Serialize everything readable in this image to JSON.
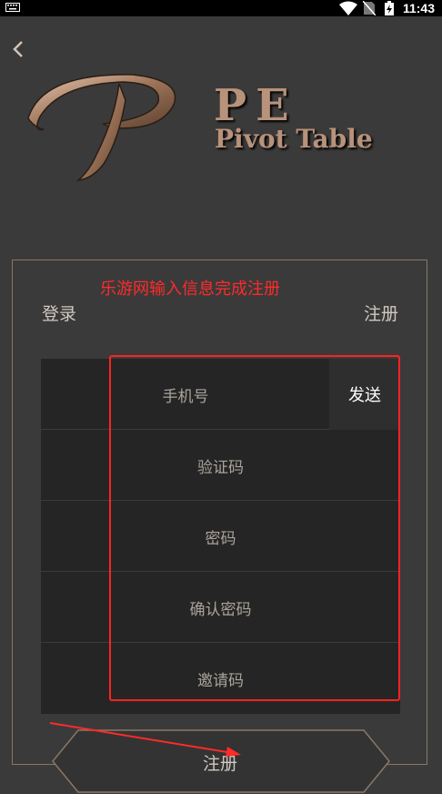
{
  "status_bar": {
    "time": "11:43",
    "icons": [
      "keyboard-icon",
      "wifi-icon",
      "no-sim-icon",
      "battery-charging-icon"
    ]
  },
  "header": {
    "back_icon": "chevron-left-icon",
    "logo_letter": "P",
    "brand_title": "PE",
    "brand_subtitle": "Pivot Table"
  },
  "annotation": {
    "text": "乐游网输入信息完成注册",
    "color": "#ff2a2a"
  },
  "tabs": {
    "login": "登录",
    "register": "注册"
  },
  "form": {
    "phone_placeholder": "手机号",
    "send_button": "发送",
    "code_placeholder": "验证码",
    "password_placeholder": "密码",
    "confirm_password_placeholder": "确认密码",
    "invite_code_placeholder": "邀请码"
  },
  "submit": {
    "label": "注册"
  },
  "colors": {
    "background": "#3a3a3a",
    "gold_accent": "#b8927a",
    "annotation_red": "#ff2a2a"
  }
}
